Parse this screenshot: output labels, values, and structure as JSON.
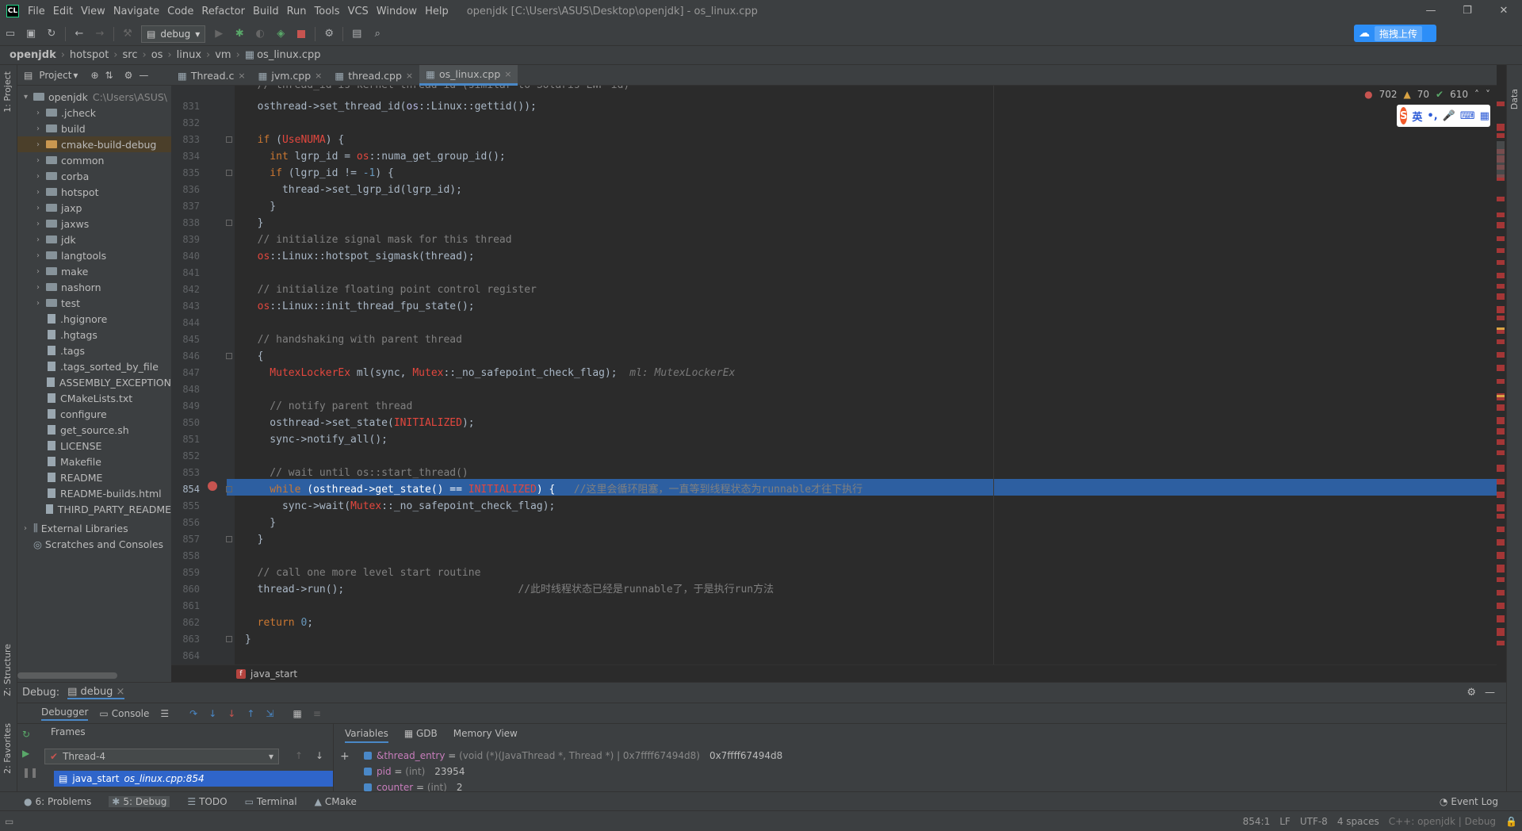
{
  "window": {
    "logo": "CL",
    "title": "openjdk [C:\\Users\\ASUS\\Desktop\\openjdk] - os_linux.cpp",
    "menu": [
      "File",
      "Edit",
      "View",
      "Navigate",
      "Code",
      "Refactor",
      "Build",
      "Run",
      "Tools",
      "VCS",
      "Window",
      "Help"
    ]
  },
  "toolbar": {
    "run_config": "debug",
    "upload_label": "拖拽上传"
  },
  "breadcrumb": [
    "openjdk",
    "hotspot",
    "src",
    "os",
    "linux",
    "vm",
    "os_linux.cpp"
  ],
  "side_tabs": {
    "project": "1: Project",
    "structure": "Z: Structure",
    "favorites": "2: Favorites",
    "right": "Data"
  },
  "project": {
    "header": "Project",
    "root": {
      "name": "openjdk",
      "path": "C:\\Users\\ASUS\\"
    },
    "items": [
      {
        "label": ".jcheck",
        "kind": "folder"
      },
      {
        "label": "build",
        "kind": "folder"
      },
      {
        "label": "cmake-build-debug",
        "kind": "folder-orange"
      },
      {
        "label": "common",
        "kind": "folder"
      },
      {
        "label": "corba",
        "kind": "folder"
      },
      {
        "label": "hotspot",
        "kind": "folder"
      },
      {
        "label": "jaxp",
        "kind": "folder"
      },
      {
        "label": "jaxws",
        "kind": "folder"
      },
      {
        "label": "jdk",
        "kind": "folder"
      },
      {
        "label": "langtools",
        "kind": "folder"
      },
      {
        "label": "make",
        "kind": "folder"
      },
      {
        "label": "nashorn",
        "kind": "folder"
      },
      {
        "label": "test",
        "kind": "folder"
      },
      {
        "label": ".hgignore",
        "kind": "file"
      },
      {
        "label": ".hgtags",
        "kind": "file"
      },
      {
        "label": ".tags",
        "kind": "file"
      },
      {
        "label": ".tags_sorted_by_file",
        "kind": "file"
      },
      {
        "label": "ASSEMBLY_EXCEPTION",
        "kind": "file"
      },
      {
        "label": "CMakeLists.txt",
        "kind": "file"
      },
      {
        "label": "configure",
        "kind": "file"
      },
      {
        "label": "get_source.sh",
        "kind": "file"
      },
      {
        "label": "LICENSE",
        "kind": "file"
      },
      {
        "label": "Makefile",
        "kind": "file"
      },
      {
        "label": "README",
        "kind": "file"
      },
      {
        "label": "README-builds.html",
        "kind": "file"
      },
      {
        "label": "THIRD_PARTY_README",
        "kind": "file"
      }
    ],
    "external": "External Libraries",
    "scratches": "Scratches and Consoles"
  },
  "tabs": [
    "Thread.c",
    "jvm.cpp",
    "thread.cpp",
    "os_linux.cpp"
  ],
  "inspections": {
    "errors": "702",
    "warnings": "70",
    "ok": "610"
  },
  "ime": {
    "label": "英"
  },
  "code": {
    "lines": [
      {
        "n": "831",
        "t": [
          [
            "",
            "  osthread->set_thread_id("
          ],
          [
            "ns",
            "os"
          ],
          [
            "",
            "::Linux::gettid());"
          ]
        ]
      },
      {
        "n": "832",
        "t": []
      },
      {
        "n": "833",
        "t": [
          [
            "kw",
            "  if "
          ],
          [
            "",
            "("
          ],
          [
            "mac",
            "UseNUMA"
          ],
          [
            "",
            ") {"
          ]
        ]
      },
      {
        "n": "834",
        "t": [
          [
            "kw",
            "    int "
          ],
          [
            "",
            "lgrp_id = "
          ],
          [
            "mac",
            "os"
          ],
          [
            "",
            "::numa_get_group_id();"
          ]
        ]
      },
      {
        "n": "835",
        "t": [
          [
            "kw",
            "    if "
          ],
          [
            "",
            "(lgrp_id != "
          ],
          [
            "num",
            "-1"
          ],
          [
            "",
            ") {"
          ]
        ]
      },
      {
        "n": "836",
        "t": [
          [
            "",
            "      thread->set_lgrp_id(lgrp_id);"
          ]
        ]
      },
      {
        "n": "837",
        "t": [
          [
            "",
            "    }"
          ]
        ]
      },
      {
        "n": "838",
        "t": [
          [
            "",
            "  }"
          ]
        ]
      },
      {
        "n": "839",
        "t": [
          [
            "cm",
            "  // initialize signal mask for this thread"
          ]
        ]
      },
      {
        "n": "840",
        "t": [
          [
            "mac",
            "  os"
          ],
          [
            "",
            "::Linux::hotspot_sigmask(thread);"
          ]
        ]
      },
      {
        "n": "841",
        "t": []
      },
      {
        "n": "842",
        "t": [
          [
            "cm",
            "  // initialize floating point control register"
          ]
        ]
      },
      {
        "n": "843",
        "t": [
          [
            "mac",
            "  os"
          ],
          [
            "",
            "::Linux::init_thread_fpu_state();"
          ]
        ]
      },
      {
        "n": "844",
        "t": []
      },
      {
        "n": "845",
        "t": [
          [
            "cm",
            "  // handshaking with parent thread"
          ]
        ]
      },
      {
        "n": "846",
        "t": [
          [
            "",
            "  {"
          ]
        ]
      },
      {
        "n": "847",
        "t": [
          [
            "mac",
            "    MutexLockerEx "
          ],
          [
            "",
            "ml(sync, "
          ],
          [
            "mac",
            "Mutex"
          ],
          [
            "",
            "::_no_safepoint_check_flag);  "
          ],
          [
            "hint",
            "ml: MutexLockerEx"
          ]
        ]
      },
      {
        "n": "848",
        "t": []
      },
      {
        "n": "849",
        "t": [
          [
            "cm",
            "    // notify parent thread"
          ]
        ]
      },
      {
        "n": "850",
        "t": [
          [
            "",
            "    osthread->set_state("
          ],
          [
            "mac",
            "INITIALIZED"
          ],
          [
            "",
            ");"
          ]
        ]
      },
      {
        "n": "851",
        "t": [
          [
            "",
            "    sync->notify_all();"
          ]
        ]
      },
      {
        "n": "852",
        "t": []
      },
      {
        "n": "853",
        "t": [
          [
            "cm",
            "    // wait until os::start_thread()"
          ]
        ]
      },
      {
        "n": "854",
        "t": [
          [
            "kw",
            "    while "
          ],
          [
            "",
            "(osthread->get_state() == "
          ],
          [
            "mac",
            "INITIALIZED"
          ],
          [
            "",
            ") {   "
          ],
          [
            "cm",
            "//这里会循环阻塞，一直等到线程状态为runnable才往下执行"
          ]
        ]
      },
      {
        "n": "855",
        "t": [
          [
            "",
            "      sync->wait("
          ],
          [
            "mac",
            "Mutex"
          ],
          [
            "",
            "::_no_safepoint_check_flag);"
          ]
        ]
      },
      {
        "n": "856",
        "t": [
          [
            "",
            "    }"
          ]
        ]
      },
      {
        "n": "857",
        "t": [
          [
            "",
            "  }"
          ]
        ]
      },
      {
        "n": "858",
        "t": []
      },
      {
        "n": "859",
        "t": [
          [
            "cm",
            "  // call one more level start routine"
          ]
        ]
      },
      {
        "n": "860",
        "t": [
          [
            "",
            "  thread->run();                            "
          ],
          [
            "cm",
            "//此时线程状态已经是runnable了，于是执行run方法"
          ]
        ]
      },
      {
        "n": "861",
        "t": []
      },
      {
        "n": "862",
        "t": [
          [
            "kw",
            "  return "
          ],
          [
            "num",
            "0"
          ],
          [
            "",
            ";"
          ]
        ]
      },
      {
        "n": "863",
        "t": [
          [
            "",
            "}"
          ]
        ]
      },
      {
        "n": "864",
        "t": []
      }
    ],
    "top_partial": "  // thread_id is kernel thread id (similar to Solaris LWP id)"
  },
  "function_bar": "java_start",
  "debug": {
    "title": "Debug:",
    "session": "debug",
    "tabs": {
      "debugger": "Debugger",
      "console": "Console"
    },
    "frames_label": "Frames",
    "thread": "Thread-4",
    "frame": {
      "name": "java_start",
      "loc": "os_linux.cpp:854"
    },
    "var_tabs": [
      "Variables",
      "GDB",
      "Memory View"
    ],
    "variables": [
      {
        "name": "&thread_entry",
        "eq": " = ",
        "type": "(void (*)(JavaThread *, Thread *) | 0x7ffff67494d8)",
        "value": "0x7ffff67494d8"
      },
      {
        "name": "pid",
        "eq": " = ",
        "type": "(int)",
        "value": "23954"
      },
      {
        "name": "counter",
        "eq": " = ",
        "type": "(int)",
        "value": "2"
      }
    ]
  },
  "bottom_tabs": [
    "6: Problems",
    "5: Debug",
    "TODO",
    "Terminal",
    "CMake"
  ],
  "event_log": "Event Log",
  "status": {
    "pos": "854:1",
    "eol": "LF",
    "enc": "UTF-8",
    "indent": "4 spaces",
    "ctx": "C++: openjdk | Debug"
  },
  "colors": {
    "exec_line": "#2d5fa1",
    "accent": "#4a88c7"
  }
}
